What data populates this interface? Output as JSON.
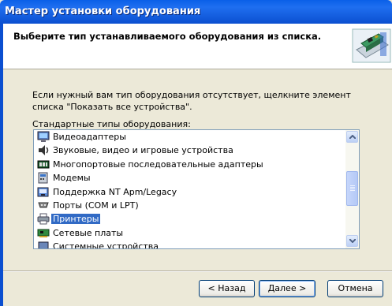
{
  "window": {
    "title": "Мастер установки оборудования"
  },
  "header": {
    "text": "Выберите тип устанавливаемого оборудования из списка."
  },
  "intro": {
    "text": "Если нужный вам тип оборудования отсутствует, щелкните элемент списка \"Показать все устройства\"."
  },
  "list": {
    "caption": "Стандартные типы оборудования:",
    "items": [
      {
        "label": "Видеоадаптеры",
        "icon": "display-adapter-icon"
      },
      {
        "label": "Звуковые, видео и игровые устройства",
        "icon": "sound-video-game-icon"
      },
      {
        "label": "Многопортовые последовательные адаптеры",
        "icon": "multiport-serial-icon"
      },
      {
        "label": "Модемы",
        "icon": "modem-icon"
      },
      {
        "label": "Поддержка NT Apm/Legacy",
        "icon": "nt-apm-icon"
      },
      {
        "label": "Порты (COM и LPT)",
        "icon": "ports-icon"
      },
      {
        "label": "Принтеры",
        "icon": "printer-icon",
        "selected": true
      },
      {
        "label": "Сетевые платы",
        "icon": "network-card-icon"
      },
      {
        "label": "Системные устройства",
        "icon": "system-device-icon"
      }
    ]
  },
  "buttons": {
    "back": "< Назад",
    "next": "Далее >",
    "cancel": "Отмена"
  },
  "colors": {
    "title_bar": "#0b4fd0",
    "selection": "#316ac5",
    "dialog": "#ece9d8"
  }
}
